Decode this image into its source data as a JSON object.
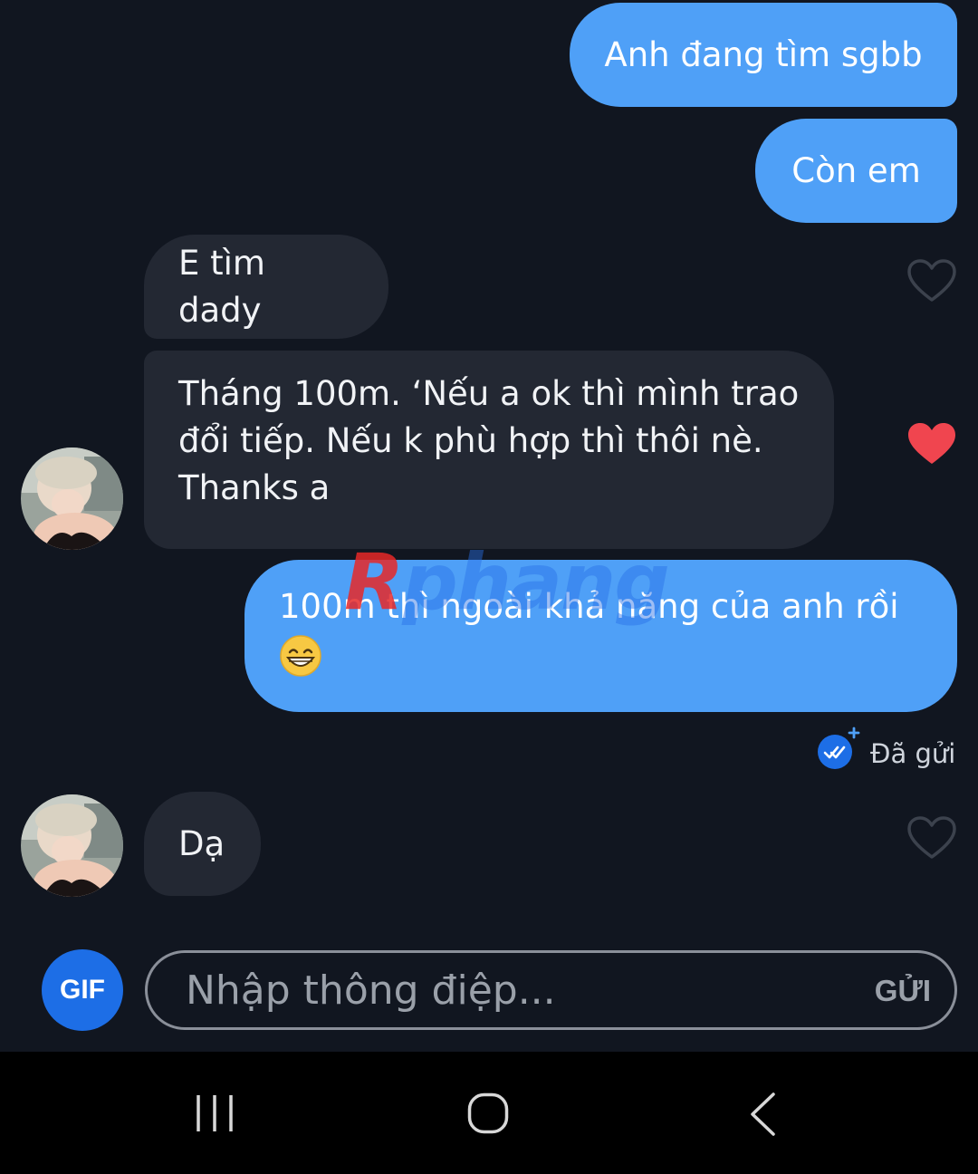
{
  "messages": [
    {
      "id": "b1",
      "direction": "sent",
      "text": "Anh đang tìm sgbb"
    },
    {
      "id": "b2",
      "direction": "sent",
      "text": "Còn em"
    },
    {
      "id": "b3",
      "direction": "received",
      "text": "E tìm dady",
      "liked": false
    },
    {
      "id": "b4",
      "direction": "received",
      "lines": [
        "Tháng 100m. ‘Nếu a ok thì mình trao",
        "đổi tiếp. Nếu k phù hợp thì thôi nè.",
        "Thanks a"
      ],
      "liked": true
    },
    {
      "id": "b5",
      "direction": "sent",
      "lines": [
        "100m thì ngoài khả năng của anh rồi"
      ],
      "emoji": "grinning-face-emoji"
    },
    {
      "id": "b6",
      "direction": "received",
      "text": "Dạ",
      "liked": false
    }
  ],
  "read_status": "Đã gửi",
  "watermark": {
    "first": "R",
    "rest": "phang"
  },
  "composer": {
    "gif_label": "GIF",
    "placeholder": "Nhập thông điệp...",
    "send_label": "GỬI"
  },
  "colors": {
    "background": "#111620",
    "sent_bubble": "#4fa0f7",
    "received_bubble": "#232833",
    "like_active": "#f0454f",
    "gif_button": "#1d6ee6"
  },
  "icons": {
    "like": "heart-icon",
    "read_receipt": "double-check-icon",
    "nav": [
      "recent-apps-icon",
      "home-icon",
      "back-icon"
    ]
  }
}
